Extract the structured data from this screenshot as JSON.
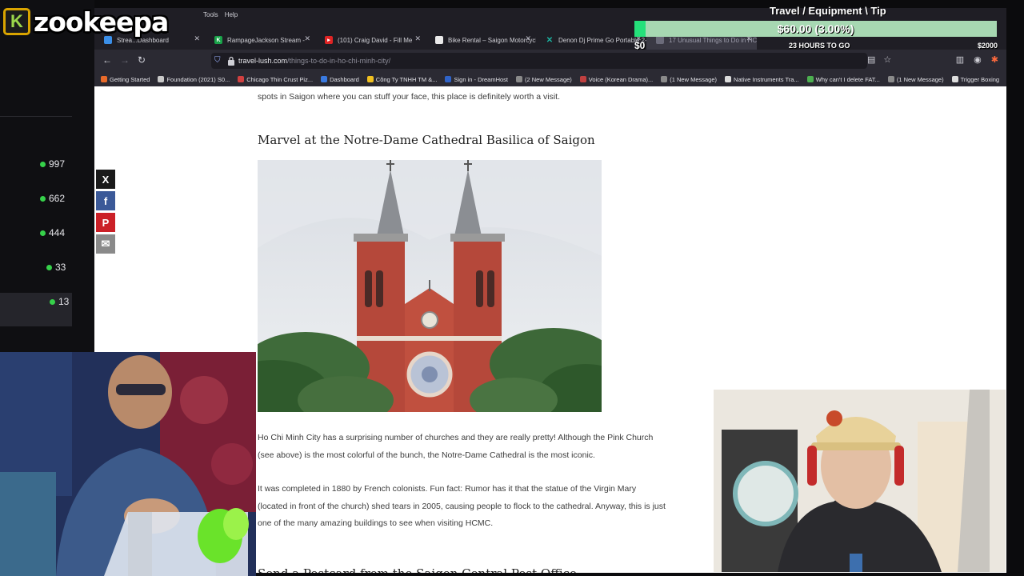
{
  "overlay": {
    "logo_letter": "K",
    "logo_text": "zookeepa",
    "goal_title": "Travel / Equipment \\ Tip",
    "goal_amount": "$60.00 (3.00%)",
    "goal_progress_pct": 3.0,
    "goal_min": "$0",
    "goal_max": "$2000",
    "goal_time": "23 HOURS TO GO",
    "colors": {
      "goal_fill": "#25e07a",
      "goal_bg": "#a7d8b2",
      "logo_border": "#d9a400"
    }
  },
  "left_panel": {
    "counts": [
      "997",
      "662",
      "444",
      "33",
      "13"
    ]
  },
  "browser": {
    "menu": [
      "Tools",
      "Help"
    ],
    "tabs": [
      {
        "label": "Strea...Dashboard",
        "color": "#3b8fe8"
      },
      {
        "label": "RampageJackson Stream -",
        "color": "#1aa34a"
      },
      {
        "label": "(101) Craig David - Fill Me",
        "color": "#e02424"
      },
      {
        "label": "Bike Rental – Saigon Motorcycl",
        "color": "#eaeaea"
      },
      {
        "label": "Denon Dj Prime Go Portable 2-",
        "color": "#1bb3a0"
      },
      {
        "label": "17 Unusual Things to Do in HC",
        "color": "#6b6b7a"
      }
    ],
    "url_host": "travel-lush.com",
    "url_path": "/things-to-do-in-ho-chi-minh-city/",
    "bookmarks": [
      {
        "label": "Getting Started",
        "color": "#e86a2a"
      },
      {
        "label": "Foundation (2021) S0...",
        "color": "#c9c9c9"
      },
      {
        "label": "Chicago Thin Crust Piz...",
        "color": "#d04040"
      },
      {
        "label": "Dashboard",
        "color": "#3a7ae0"
      },
      {
        "label": "Công Ty TNHH TM &...",
        "color": "#f0c020"
      },
      {
        "label": "Sign in - DreamHost",
        "color": "#2f63c8"
      },
      {
        "label": "(2 New Message)",
        "color": "#8a8a8a"
      },
      {
        "label": "Voice (Korean Drama)...",
        "color": "#c04040"
      },
      {
        "label": "(1 New Message)",
        "color": "#8a8a8a"
      },
      {
        "label": "Native Instruments Tra...",
        "color": "#dddddd"
      },
      {
        "label": "Why can't I delete FAT...",
        "color": "#4caf50"
      },
      {
        "label": "(1 New Message)",
        "color": "#8a8a8a"
      },
      {
        "label": "Trigger Boxing",
        "color": "#dddddd"
      }
    ]
  },
  "article": {
    "intro_tail": "spots in Saigon where you can stuff your face, this place is definitely worth a visit.",
    "heading1": "Marvel at the Notre-Dame Cathedral Basilica of Saigon",
    "para1": "Ho Chi Minh City has a surprising number of churches and they are really pretty! Although the Pink Church (see above) is the most colorful of the bunch, the Notre-Dame Cathedral is the most iconic.",
    "para2": "It was completed in 1880 by French colonists. Fun fact: Rumor has it that the statue of the Virgin Mary (located in front of the church) shed tears in 2005, causing people to flock to the cathedral. Anyway, this is just one of the many amazing buildings to see when visiting HCMC.",
    "heading2": "Send a Postcard from the Saigon Central Post Office"
  },
  "share": [
    {
      "icon": "x-icon",
      "glyph": "X",
      "color": "#1a1a1a"
    },
    {
      "icon": "facebook-icon",
      "glyph": "f",
      "color": "#3b5998"
    },
    {
      "icon": "pinterest-icon",
      "glyph": "P",
      "color": "#cb2027"
    },
    {
      "icon": "email-icon",
      "glyph": "✉",
      "color": "#8a8a8a"
    }
  ]
}
